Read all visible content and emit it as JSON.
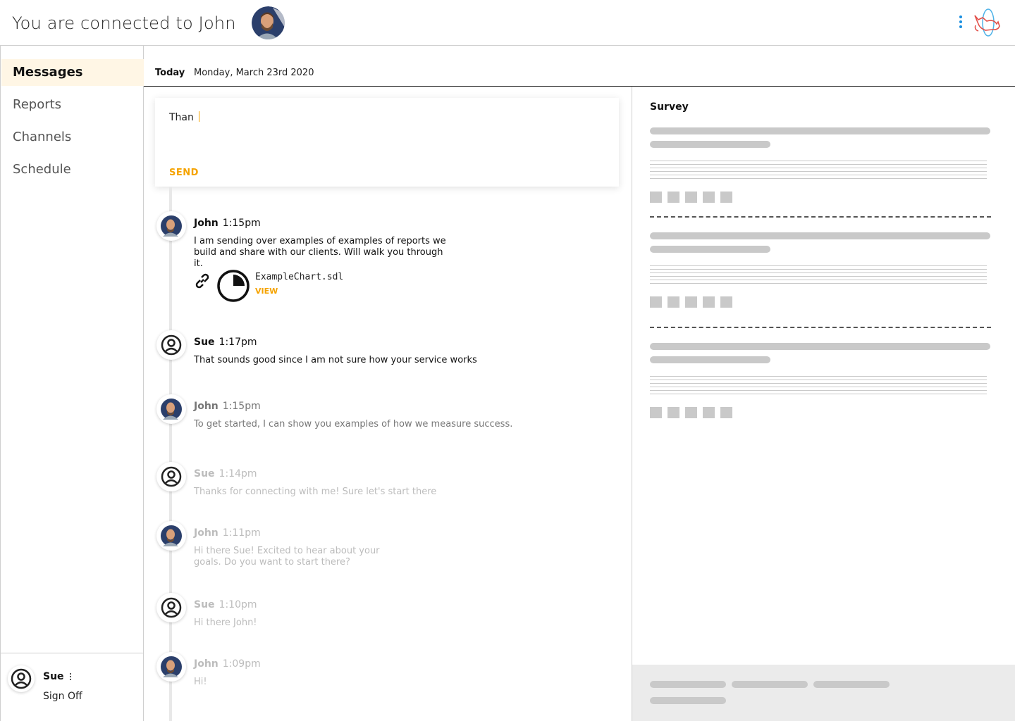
{
  "header": {
    "title": "You are connected to John",
    "avatar": "john-avatar",
    "menu_icon": "kebab-menu-icon",
    "logo_icon": "cat-rocket-logo-icon"
  },
  "sidebar": {
    "items": [
      {
        "label": "Messages",
        "active": true
      },
      {
        "label": "Reports",
        "active": false
      },
      {
        "label": "Channels",
        "active": false
      },
      {
        "label": "Schedule",
        "active": false
      }
    ],
    "user": {
      "name": "Sue",
      "signoff": "Sign Off"
    }
  },
  "datebar": {
    "today_label": "Today",
    "date": "Monday, March 23rd 2020"
  },
  "compose": {
    "value": "Than",
    "send_label": "SEND"
  },
  "messages": [
    {
      "author": "John",
      "time": "1:15pm",
      "text": "I am sending over examples of examples of reports we build and share with our clients. Will walk you through it.",
      "attachment": {
        "filename": "ExampleChart.sdl",
        "action": "VIEW"
      }
    },
    {
      "author": "Sue",
      "time": "1:17pm",
      "text": "That sounds good since I am not sure how your service works"
    },
    {
      "author": "John",
      "time": "1:15pm",
      "text": "To get started, I can show you examples of how we measure success."
    },
    {
      "author": "Sue",
      "time": "1:14pm",
      "text": "Thanks for connecting with me! Sure let's start there"
    },
    {
      "author": "John",
      "time": "1:11pm",
      "text": "Hi there Sue! Excited to hear about your goals. Do you want to start there?"
    },
    {
      "author": "Sue",
      "time": "1:10pm",
      "text": "Hi there John!"
    },
    {
      "author": "John",
      "time": "1:09pm",
      "text": "Hi!"
    }
  ],
  "survey": {
    "title": "Survey"
  },
  "colors": {
    "accent": "#f5a300",
    "active_nav_bg": "#fff6e5",
    "placeholder": "#c9c9c9",
    "menu_dots": "#1a8fe0"
  }
}
